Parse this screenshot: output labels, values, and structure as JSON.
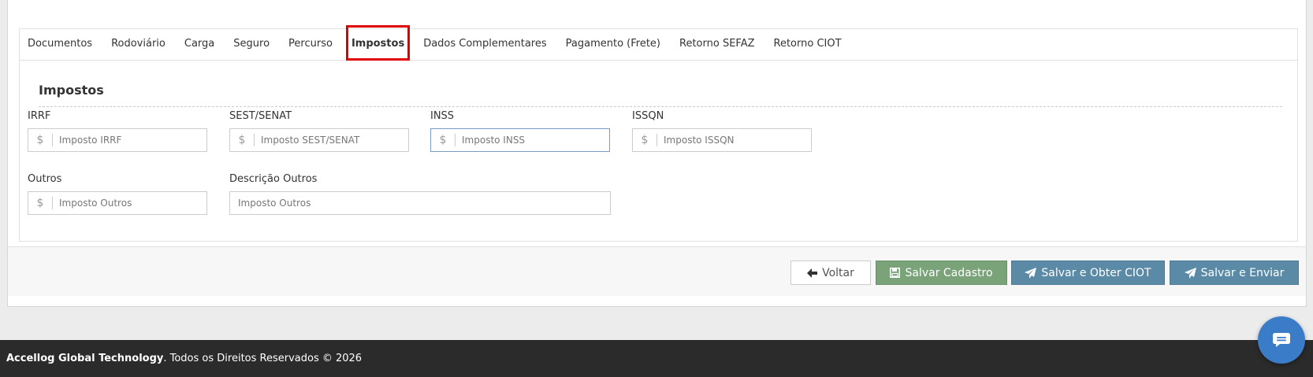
{
  "tabs": [
    {
      "label": "Documentos"
    },
    {
      "label": "Rodoviário"
    },
    {
      "label": "Carga"
    },
    {
      "label": "Seguro"
    },
    {
      "label": "Percurso"
    },
    {
      "label": "Impostos",
      "active": true
    },
    {
      "label": "Dados Complementares"
    },
    {
      "label": "Pagamento (Frete)"
    },
    {
      "label": "Retorno SEFAZ"
    },
    {
      "label": "Retorno CIOT"
    }
  ],
  "section": {
    "title": "Impostos"
  },
  "fields": {
    "irrf": {
      "label": "IRRF",
      "addon": "$",
      "value": "",
      "placeholder": "Imposto IRRF"
    },
    "sest": {
      "label": "SEST/SENAT",
      "addon": "$",
      "value": "",
      "placeholder": "Imposto SEST/SENAT"
    },
    "inss": {
      "label": "INSS",
      "addon": "$",
      "value": "",
      "placeholder": "Imposto INSS"
    },
    "issqn": {
      "label": "ISSQN",
      "addon": "$",
      "value": "",
      "placeholder": "Imposto ISSQN"
    },
    "outros": {
      "label": "Outros",
      "addon": "$",
      "value": "",
      "placeholder": "Imposto Outros"
    },
    "descricao_outros": {
      "label": "Descrição Outros",
      "value": "",
      "placeholder": "Imposto Outros"
    }
  },
  "actions": {
    "back": "Voltar",
    "save": "Salvar Cadastro",
    "save_ciot": "Salvar e Obter CIOT",
    "save_send": "Salvar e Enviar"
  },
  "footer": {
    "company": "Accellog Global Technology",
    "rights": ". Todos os Direitos Reservados © 2026"
  },
  "colors": {
    "save_button": "#7aa37a",
    "send_button": "#5b8aa6",
    "active_tab_highlight": "#e00000",
    "chat_button": "#3a7cc8",
    "footer_bg": "#2b2b2b"
  },
  "icons": {
    "back": "arrow-left-icon",
    "save": "floppy-disk-icon",
    "send": "paper-plane-icon",
    "chat": "chat-bubble-icon"
  }
}
